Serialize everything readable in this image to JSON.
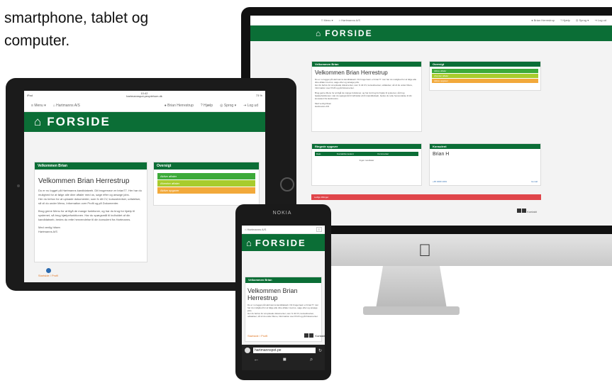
{
  "intro_text": {
    "line1": "smartphone, tablet og",
    "line2": "computer."
  },
  "nav": {
    "menu": "Menu",
    "company": "Hartmanns A/S",
    "user": "Brian Herrestrup",
    "help": "Hjælp",
    "language": "Sprog",
    "logout": "Log ud"
  },
  "banner": {
    "title": "FORSIDE"
  },
  "welcome": {
    "header": "Velkommen Brian",
    "title": "Velkommen Brian Herrestrup",
    "title_line1": "Velkommen Brian",
    "title_line2": "Herrestrup",
    "body1": "Du er nu logget på Hartmanns kandidatweb. Dit brugernavn er brian77. Her har du mulighed for at følge alle dine aftaler med os, søge efter og ansøge jobs.",
    "body2": "Her du behov for at uploade dokumenter, som fx dit CV, kursusbeviser, udtalelser, så vil du under Menu, Information over Profil og på Dokumenter.",
    "body3": "Brug gerne Menu for at tilgå de mange funktioner, og har du brug for hjælp til systemet, så brug hjælpefunktionen. Har du spørgsmål til indholdet af din kandidatweb, bedes du rette henvendelse til din konsulent fra Hartmanns.",
    "signoff": "Med venlig hilsen",
    "company": "Hartmanns A/S"
  },
  "overview": {
    "header": "Oversigt",
    "rows": [
      "Aktive aftaler",
      "Afventer aftaler",
      "Aktive opgaver"
    ]
  },
  "ipad_status": {
    "carrier": "iPad",
    "time": "10:42",
    "url": "hartmannspot.peoplehum.dk",
    "battery": "73 %"
  },
  "ipad_home": {
    "label": "Startside / Profil"
  },
  "imac_extra": {
    "jobs_header": "Ringede opgaver",
    "jobs_cols": [
      "Dato",
      "Kontakt/konsulent",
      "Kommentar"
    ],
    "jobs_empty": "Ingen resultater",
    "consultant_header": "Konsulent",
    "consultant_name": "Brian H",
    "consultant_phone": "+45 4000 1001",
    "consultant_email": "E-mail",
    "alert": "Ledige tilbinger",
    "footer_contact": "Kontakt"
  },
  "phone": {
    "brand": "NOKIA",
    "url": "hartmannspot.pe",
    "home": "Startside / Profil",
    "contact": "Kontakt"
  }
}
